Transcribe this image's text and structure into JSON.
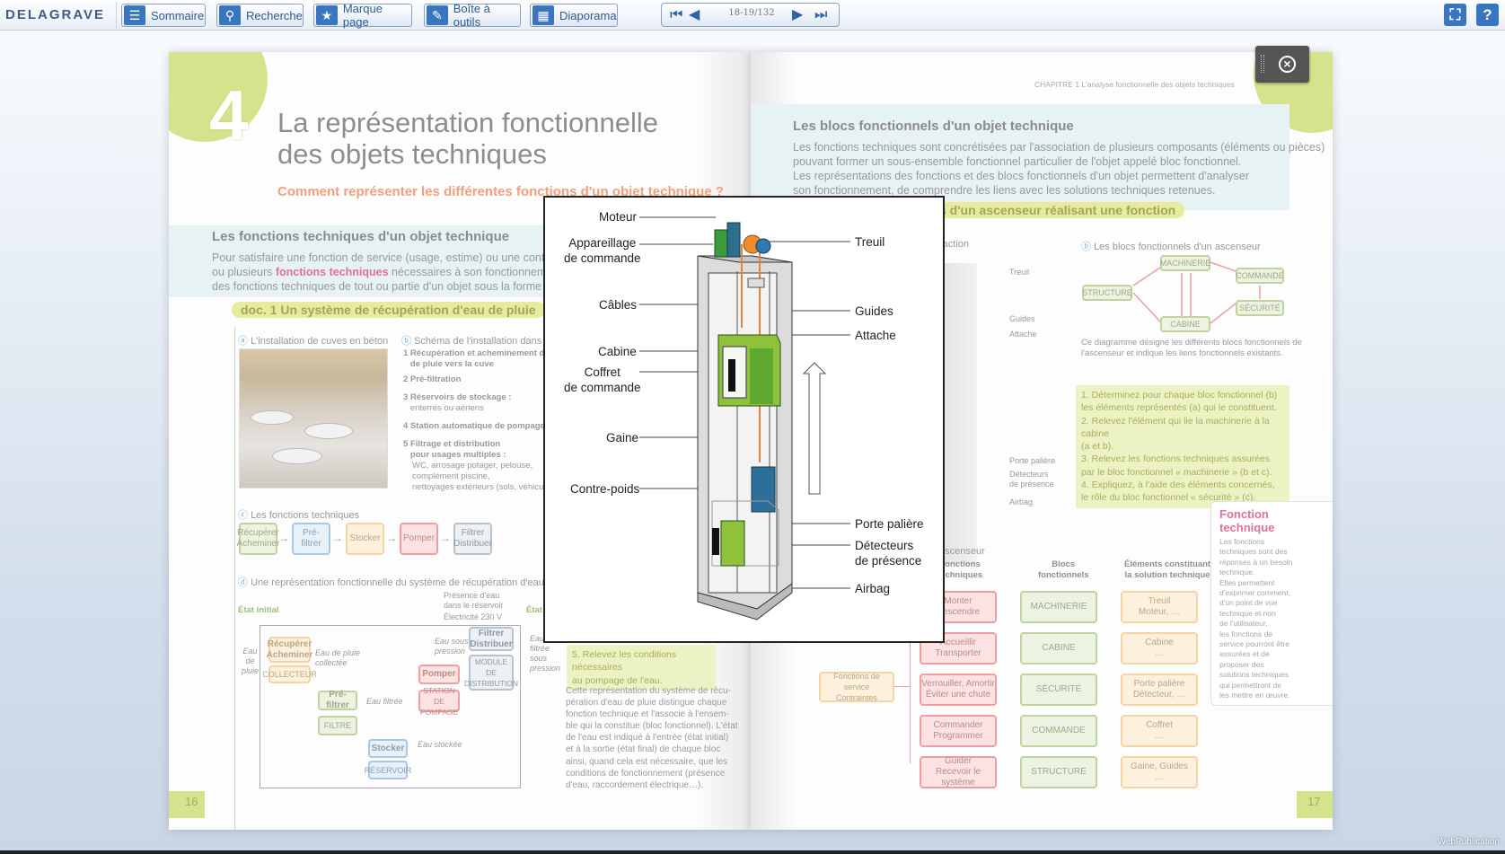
{
  "toolbar": {
    "brand": "DELAGRAVE",
    "buttons": [
      "Sommaire",
      "Recherche",
      "Marque page",
      "Boîte à outils",
      "Diaporama"
    ],
    "page_indicator": "18-19/132",
    "fullscreen_icon": "fullscreen-icon",
    "help": "?"
  },
  "left_page": {
    "chapter_number": "4",
    "title_line1": "La représentation fonctionnelle",
    "title_line2": "des objets techniques",
    "subtitle": "Comment représenter les différentes fonctions d'un objet technique ?",
    "section_heading": "Les fonctions techniques d'un objet technique",
    "intro_line1": "Pour satisfaire une fonction de service (usage, estime) ou une contrainte, u",
    "intro_line2_pre": "ou plusieurs ",
    "intro_line2_em": "fonctions techniques",
    "intro_line2_post": " nécessaires à son fonctionnement. Il est p",
    "intro_line3": "des fonctions techniques de tout ou partie d'un objet sous la forme d'un sch",
    "doc_label": "doc. 1  Un système de récupération d'eau de pluie",
    "a_caption": "L'installation de cuves en béton",
    "b_caption": "Schéma de l'installation dans u",
    "b_items": [
      {
        "n": "1",
        "title": "Récupération et acheminement de l'e",
        "title2": "de pluie vers la cuve",
        "sub": ""
      },
      {
        "n": "2",
        "title": "Pré-filtration",
        "title2": "",
        "sub": ""
      },
      {
        "n": "3",
        "title": "Réservoirs de stockage :",
        "title2": "",
        "sub": "enterrés ou aériens"
      },
      {
        "n": "4",
        "title": "Station automatique de pompage",
        "title2": "",
        "sub": ""
      },
      {
        "n": "5",
        "title": "Filtrage et distribution",
        "title2": "pour usages multiples :",
        "sub": "WC, arrosage potager, pelouse,\ncomplément piscine,\nnettoyages extérieurs (sols, véhicules)"
      }
    ],
    "c_caption": "Les fonctions techniques",
    "c_boxes": [
      "Récupérer\nAcheminer",
      "Pré-filtrer",
      "Stocker",
      "Pomper",
      "Filtrer\nDistribuer"
    ],
    "c_nums": [
      "1",
      "2",
      "3",
      "4",
      "5"
    ],
    "d_caption": "Une représentation fonctionnelle du système de récupération d'eau de pl",
    "d_etat_initial": "État initial",
    "d_etat_final": "État",
    "d_eau_de_pluie": "Eau\nde\npluie",
    "d_eau_collectee": "Eau de pluie\ncollectée",
    "d_eau_filtree": "Eau filtrée",
    "d_eau_stockee": "Eau stockée",
    "d_eau_pression": "Eau sous\npression",
    "d_eau_sortie": "Eau\nfiltrée\nsous\npression",
    "d_presence": "Présence d'eau\ndans le réservoir",
    "d_electricite": "Électricité 230 V",
    "d_boxes": [
      "Récupérer\nAcheminer",
      "COLLECTEUR",
      "Pré-filtrer",
      "FILTRE",
      "Stocker",
      "RÉSERVOIR",
      "Pomper",
      "STATION DE\nPOMPAGE",
      "Filtrer\nDistribuer",
      "MODULE\nDE\nDISTRIBUTION"
    ],
    "q5": "5. Relevez les conditions nécessaires\nau pompage de l'eau.",
    "paragraph": "Cette représentation du système de récu-\npération d'eau de pluie distingue chaque\nfonction technique et l'associe à l'ensem-\nble qui la constitue (bloc fonctionnel). L'état\nde l'eau est indiqué à l'entrée (état initial)\net à la sortie (état final) de chaque bloc\nainsi, quand cela est nécessaire, que les\nconditions de fonctionnement (présence\nd'eau, raccordement électrique…).",
    "page_number": "16"
  },
  "right_page": {
    "chapter_ref": "CHAPITRE 1   L'analyse fonctionnelle des objets techniques",
    "section_heading": "Les blocs fonctionnels d'un objet technique",
    "intro": "Les fonctions techniques sont concrétisées par l'association de plusieurs composants (éléments ou pièces)\npouvant former un sous-ensemble fonctionnel particulier de l'objet appelé bloc fonctionnel.\nLes représentations des fonctions et des blocs fonctionnels d'un objet permettent d'analyser\nson fonctionnement, de comprendre les liens avec les solutions techniques retenues.",
    "doc_label_fragment": "s d'un ascenseur réalisant une fonction",
    "a_fragment": "raction",
    "a_labels": [
      "Treuil",
      "Guides",
      "Attache",
      "Porte palière",
      "Détecteurs\nde présence",
      "Airbag"
    ],
    "b_caption": "Les blocs fonctionnels d'un ascenseur",
    "b_blocks": [
      "MACHINERIE",
      "COMMANDE",
      "STRUCTURE",
      "SÉCURITÉ",
      "CABINE"
    ],
    "b_note": "Ce diagramme désigne les différents blocs fonctionnels de\nl'ascenseur et indique les liens fonctionnels existants.",
    "questions": "1. Déterminez pour chaque bloc fonctionnel (b)\nles éléments représentés (a) qui le constituent.\n2. Relevez l'élément qui lie la machinerie à la cabine\n(a et b).\n3. Relevez les fonctions techniques assurées\npar le bloc fonctionnel « machinerie » (b et c).\n4. Expliquez, à l'aide des éléments concernés,\nle rôle du bloc fonctionnel « sécurité » (c).",
    "c_fragment": "ascenseur",
    "c_headers": [
      "Fonctions\ntechniques",
      "Blocs\nfonctionnels",
      "Éléments constituant\nla solution technique"
    ],
    "c_service": "Fonctions de service\nContraintes",
    "c_functions": [
      "Monter\nDescendre",
      "Accueillir\nTransporter",
      "Verrouiller, Amortir\nÉviter une chute",
      "Commander\nProgrammer",
      "Guider\nRecevoir le système"
    ],
    "c_blocks": [
      "MACHINERIE",
      "CABINE",
      "SÉCURITÉ",
      "COMMANDE",
      "STRUCTURE"
    ],
    "c_elements": [
      "Treuil\nMoteur, …",
      "Cabine\n…",
      "Porte palière\nDétecteur, …",
      "Coffret\n…",
      "Gaine, Guides\n…"
    ],
    "sidebar_title": "Fonction\ntechnique",
    "sidebar_text": "Les fonctions\ntechniques sont des\nréponses à un besoin\ntechnique.\nElles permettent\nd'exprimer comment,\nd'un point de vue\ntechnique et non\nde l'utilisateur,\nles fonctions de\nservice pourront être\nassurées et de\nproposer des\nsolutions techniques\nqui permettront de\nles mettre en œuvre.",
    "page_number": "17"
  },
  "popup": {
    "labels_left": [
      "Moteur",
      "Appareillage\nde commande",
      "Câbles",
      "Cabine",
      "Coffret\nde commande",
      "Gaine",
      "Contre-poids"
    ],
    "labels_right": [
      "Treuil",
      "Guides",
      "Attache",
      "Porte palière",
      "Détecteurs\nde présence",
      "Airbag"
    ]
  },
  "footer": {
    "publisher_badge": "WebPublication"
  },
  "colors": {
    "accent_blue": "#3a75c0",
    "chapter_green": "#d5e38c",
    "subtitle_orange": "#f0a07a",
    "pink_keyword": "#e2709a"
  }
}
